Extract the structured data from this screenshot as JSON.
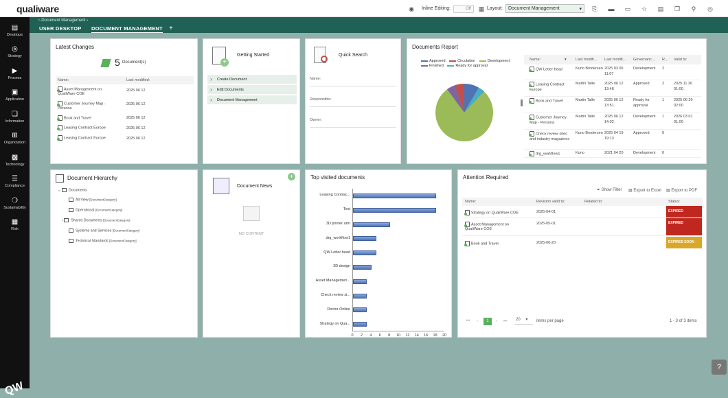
{
  "app": {
    "logo": "qualiware"
  },
  "topbar": {
    "inline_editing_label": "Inline Editing:",
    "inline_editing_value": "Off",
    "layout_label": "Layout:",
    "layout_value": "Document Management"
  },
  "sidebar": {
    "items": [
      {
        "label": "Desktops",
        "icon": "desktops-icon"
      },
      {
        "label": "Strategy",
        "icon": "strategy-icon"
      },
      {
        "label": "Process",
        "icon": "process-icon"
      },
      {
        "label": "Application",
        "icon": "application-icon"
      },
      {
        "label": "Information",
        "icon": "information-icon"
      },
      {
        "label": "Organization",
        "icon": "organization-icon"
      },
      {
        "label": "Technology",
        "icon": "technology-icon"
      },
      {
        "label": "Compliance",
        "icon": "compliance-icon"
      },
      {
        "label": "Sustainability",
        "icon": "sustainability-icon"
      },
      {
        "label": "Risk",
        "icon": "risk-icon"
      }
    ],
    "bottom_logo": "QW"
  },
  "breadcrumb": "Document Management",
  "tabs": [
    {
      "label": "USER DESKTOP"
    },
    {
      "label": "DOCUMENT MANAGEMENT"
    },
    {
      "label": "+"
    }
  ],
  "latest_changes": {
    "title": "Latest Changes",
    "count": "5",
    "count_unit": "Document(s)",
    "headers": [
      "Name:",
      "Last modified:"
    ],
    "rows": [
      {
        "name": "Asset Management on QualiWare COE",
        "date": "2025 06 12"
      },
      {
        "name": "Customer Journey Map - Persona",
        "date": "2025 06 12"
      },
      {
        "name": "Book and Travel",
        "date": "2025 06 12"
      },
      {
        "name": "Leasing Contract Europe",
        "date": "2025 06 12"
      },
      {
        "name": "Leasing Contract Europe",
        "date": "2025 06 12"
      }
    ]
  },
  "getting_started": {
    "title": "Getting Started",
    "items": [
      "Create Document",
      "Edit Documents",
      "Document Management"
    ]
  },
  "quick_search": {
    "title": "Quick Search",
    "fields": [
      "Name:",
      "Responsible:",
      "Owner:"
    ]
  },
  "documents_report": {
    "title": "Documents Report",
    "legend": [
      {
        "label": "Approved",
        "color": "#4f73b5"
      },
      {
        "label": "Circulation",
        "color": "#c0504d"
      },
      {
        "label": "Development",
        "color": "#9bbb59"
      },
      {
        "label": "Finished",
        "color": "#8064a2"
      },
      {
        "label": "Ready for approval",
        "color": "#4bacc6"
      }
    ],
    "headers": [
      "Name:",
      "Last modifi...",
      "Last modifi...",
      "Governanc...",
      "R...",
      "Valid to:"
    ],
    "rows": [
      [
        "QW Letter head",
        "Kuno Brodersen",
        "2025 03 06 11:07",
        "Development",
        "2",
        ""
      ],
      [
        "Leasing Contract Europe",
        "Martin Talle",
        "2025 06 12 13:48",
        "Approved",
        "2",
        "2025 11 30 01:00"
      ],
      [
        "Book and Travel",
        "Martin Talle",
        "2025 06 12 13:51",
        "Ready for approval",
        "1",
        "2025 06 20 02:00"
      ],
      [
        "Customer Journey Map - Persona",
        "Martin Talle",
        "2025 06 12 14:02",
        "Development",
        "1",
        "2026 03 01 01:00"
      ],
      [
        "Check review sites and industry magazines",
        "Kuno Brodersen",
        "2025 04 19 19:13",
        "Approved",
        "0",
        ""
      ],
      [
        "drg_workflow1",
        "Kuno",
        "2021 04 20",
        "Development",
        "0",
        ""
      ]
    ]
  },
  "document_hierarchy": {
    "title": "Document Hierarchy",
    "root": "Documents",
    "items": [
      {
        "label": "All View",
        "type": "[DocumentCategory]"
      },
      {
        "label": "Operational",
        "type": "[DocumentCategory]"
      },
      {
        "label": "Shared Documents",
        "type": "[DocumentCategory]"
      },
      {
        "label": "Systems and Services",
        "type": "[DocumentCategory]"
      },
      {
        "label": "Technical Standards",
        "type": "[DocumentCategory]"
      }
    ]
  },
  "document_news": {
    "title": "Document News",
    "empty": "NO CONTENT"
  },
  "top_visited": {
    "title": "Top visited documents"
  },
  "chart_data": {
    "type": "bar",
    "orientation": "horizontal",
    "title": "Top visited documents",
    "categories": [
      "Leasing Contrac...",
      "Test",
      "3D printer arm",
      "drg_workflow1",
      "QW Letter head",
      "3D design",
      "Asset Managemen...",
      "Check review si...",
      "Doctor Online",
      "Strategy on Qua..."
    ],
    "values": [
      18,
      18,
      8,
      5,
      5,
      4,
      3,
      3,
      3,
      3
    ],
    "xlim": [
      0,
      20
    ],
    "xticks": [
      "0",
      "2",
      "4",
      "6",
      "8",
      "10",
      "12",
      "14",
      "16",
      "18",
      "20"
    ],
    "color": "#4f73b5"
  },
  "attention": {
    "title": "Attention Required",
    "actions": [
      "Show Filter",
      "Export to Excel",
      "Export to PDF"
    ],
    "headers": [
      "Name:",
      "Revision valid to:",
      "Related to:",
      "Status:"
    ],
    "rows": [
      {
        "name": "Strategy on QualiWare COE",
        "date": "2025-04-01",
        "status": "EXPIRED",
        "color": "#c0271e"
      },
      {
        "name": "Asset Management on QualiWare COE",
        "date": "2025-05-01",
        "status": "EXPIRED",
        "color": "#c0271e"
      },
      {
        "name": "Book and Travel",
        "date": "2025-06-20",
        "status": "EXPIRES SOON",
        "color": "#d9a82b"
      }
    ],
    "pager": {
      "page": "1",
      "page_size": "20",
      "per_page_label": "items per page",
      "summary": "1 - 3 of 3 items"
    }
  },
  "help": "?"
}
